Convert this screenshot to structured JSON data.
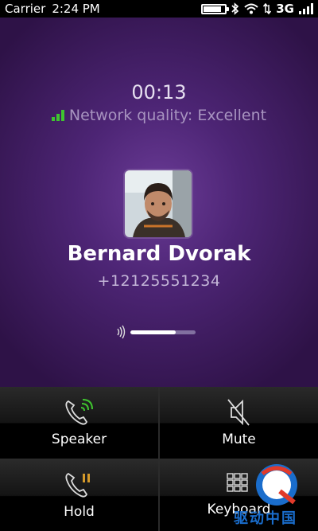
{
  "status": {
    "carrier": "Carrier",
    "time": "2:24 PM",
    "network": "3G",
    "battery_level": 0.85,
    "icons": [
      "battery-icon",
      "bluetooth-icon",
      "wifi-icon",
      "signal-icon"
    ]
  },
  "call": {
    "duration": "00:13",
    "quality_text": "Network quality: Excellent",
    "quality_color": "#3fc52f",
    "contact_name": "Bernard Dvorak",
    "contact_number": "+12125551234",
    "volume_level": 0.7
  },
  "controls": [
    {
      "id": "speaker",
      "label": "Speaker",
      "icon": "speaker-phone-icon"
    },
    {
      "id": "mute",
      "label": "Mute",
      "icon": "mute-icon"
    },
    {
      "id": "hold",
      "label": "Hold",
      "icon": "hold-phone-icon"
    },
    {
      "id": "keyboard",
      "label": "Keyboard",
      "icon": "keypad-icon"
    }
  ],
  "watermark": {
    "text": "驱动中国"
  },
  "colors": {
    "call_bg_center": "#6a3b96",
    "call_bg_edge": "#2e1247",
    "accent_green": "#3fc52f",
    "hold_accent": "#d59a2a"
  }
}
